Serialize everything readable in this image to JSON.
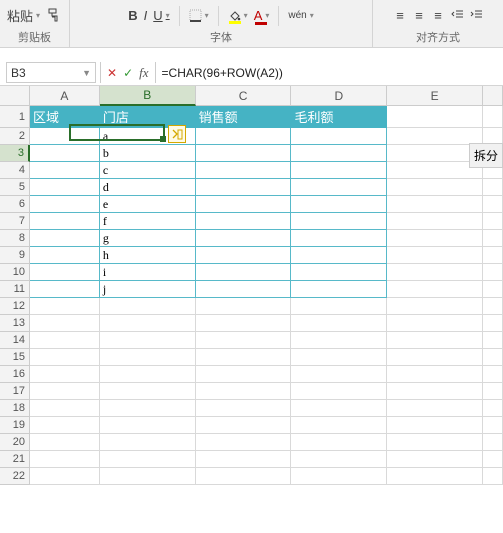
{
  "ribbon": {
    "clipboard": {
      "paste": "粘贴",
      "label": "剪贴板"
    },
    "font": {
      "bold": "B",
      "italic": "I",
      "underline": "U",
      "border_icon": "border-bottom-icon",
      "fill_icon": "paint-bucket-icon",
      "font_color_icon": "A",
      "phonetic": "wén",
      "label": "字体"
    },
    "align": {
      "label": "对齐方式"
    }
  },
  "fxbar": {
    "namebox": "B3",
    "cancel": "✕",
    "enter": "✓",
    "fx": "fx",
    "formula": "=CHAR(96+ROW(A2))"
  },
  "sheet": {
    "cols": [
      "A",
      "B",
      "C",
      "D",
      "E"
    ],
    "col_widths": {
      "A": 70,
      "B": 96,
      "C": 96,
      "D": 96,
      "E": 96
    },
    "rows": 22,
    "active_col": "B",
    "active_row": 3,
    "headers": {
      "A": "区域",
      "B": "门店",
      "C": "销售额",
      "D": "毛利额"
    },
    "data_b": [
      "a",
      "b",
      "c",
      "d",
      "e",
      "f",
      "g",
      "h",
      "i",
      "j"
    ],
    "side_button": "拆分"
  }
}
